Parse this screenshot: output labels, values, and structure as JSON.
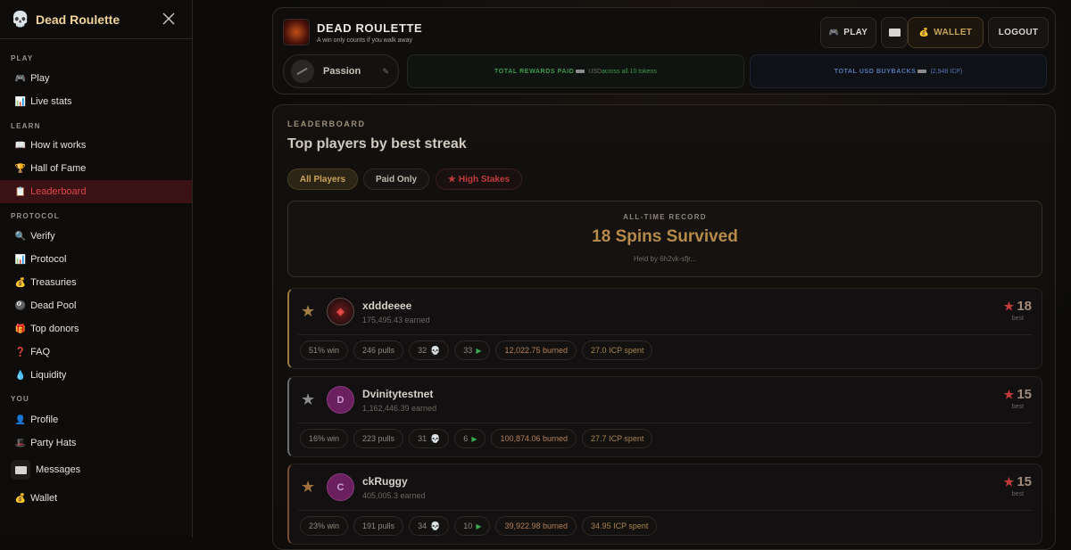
{
  "sidebar": {
    "brand": "Dead Roulette",
    "sections": {
      "play": "PLAY",
      "learn": "LEARN",
      "protocol": "PROTOCOL",
      "you": "YOU"
    },
    "items": [
      {
        "label": "Play",
        "icon": "🎮"
      },
      {
        "label": "Live stats",
        "icon": "📊"
      },
      {
        "label": "How it works",
        "icon": "📖"
      },
      {
        "label": "Hall of Fame",
        "icon": "🏆"
      },
      {
        "label": "Leaderboard",
        "icon": "📋"
      },
      {
        "label": "Verify",
        "icon": "🔍"
      },
      {
        "label": "Protocol",
        "icon": "📊"
      },
      {
        "label": "Treasuries",
        "icon": "💰"
      },
      {
        "label": "Dead Pool",
        "icon": "🎱"
      },
      {
        "label": "Top donors",
        "icon": "🎁"
      },
      {
        "label": "FAQ",
        "icon": "❓"
      },
      {
        "label": "Liquidity",
        "icon": "💧"
      },
      {
        "label": "Profile",
        "icon": "👤"
      },
      {
        "label": "Party Hats",
        "icon": "🎩"
      },
      {
        "label": "Messages",
        "icon": "envelope"
      },
      {
        "label": "Wallet",
        "icon": "💰"
      }
    ],
    "active": "Leaderboard"
  },
  "header": {
    "title": "DEAD ROULETTE",
    "subtitle": "A win only counts if you walk away",
    "buttons": {
      "play": "PLAY",
      "wallet": "WALLET",
      "logout": "LOGOUT"
    },
    "pass_label": "Passion",
    "rewards_label": "TOTAL REWARDS PAID",
    "rewards_unit": "USD",
    "rewards_sub": "across all 10 tokens",
    "buybacks_label": "TOTAL USD BUYBACKS",
    "buybacks_value": "(2,948 ICP)"
  },
  "leaderboard": {
    "eyebrow": "LEADERBOARD",
    "title": "Top players by best streak",
    "filters": [
      "All Players",
      "Paid Only",
      "High Stakes"
    ],
    "record_label": "ALL-TIME RECORD",
    "record_value": "18 Spins Survived",
    "record_holder": "Held by 6h2vk-sfjr...",
    "best_label": "best",
    "players": [
      {
        "name": "xdddeeee",
        "earned": "175,495.43 earned",
        "avatar": "",
        "best": "18",
        "stats": [
          "51% win",
          "246 pulls",
          "32",
          "33",
          "12,022.75 burned",
          "27.0 ICP spent"
        ]
      },
      {
        "name": "Dvinitytestnet",
        "earned": "1,162,446.39 earned",
        "avatar": "D",
        "best": "15",
        "stats": [
          "16% win",
          "223 pulls",
          "31",
          "6",
          "100,874.06 burned",
          "27.7 ICP spent"
        ]
      },
      {
        "name": "ckRuggy",
        "earned": "405,005.3 earned",
        "avatar": "C",
        "best": "15",
        "stats": [
          "23% win",
          "191 pulls",
          "34",
          "10",
          "39,922.98 burned",
          "34.95 ICP spent"
        ]
      }
    ]
  },
  "colors": {
    "accent": "#c9a35c",
    "danger": "#c03b3b",
    "active_bg": "#3a1114"
  }
}
